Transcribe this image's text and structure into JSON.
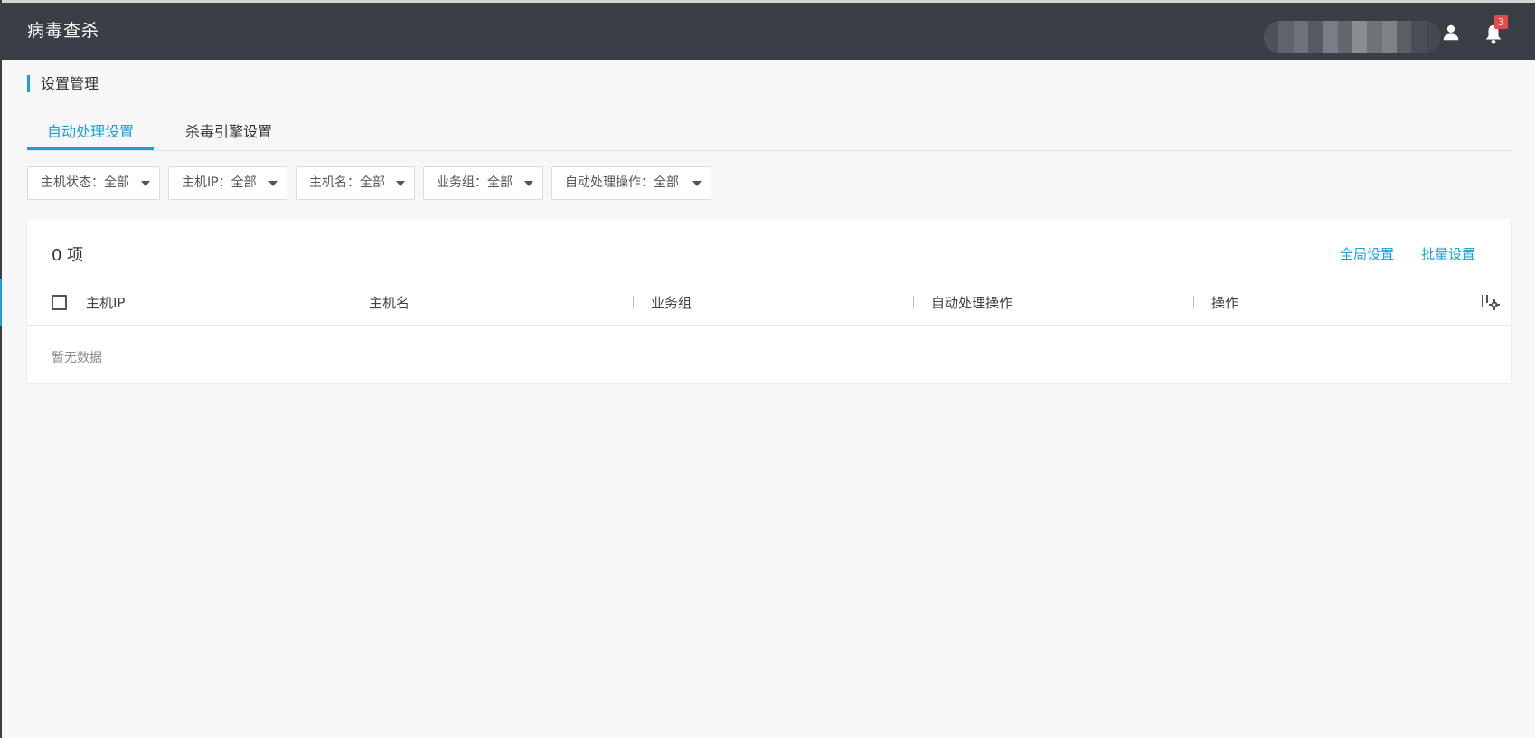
{
  "app": {
    "title": "病毒查杀"
  },
  "header": {
    "notification_count": "3"
  },
  "section": {
    "title": "设置管理"
  },
  "tabs": [
    {
      "label": "自动处理设置",
      "active": true
    },
    {
      "label": "杀毒引擎设置",
      "active": false
    }
  ],
  "filters": [
    {
      "label": "主机状态：全部"
    },
    {
      "label": "主机IP：全部"
    },
    {
      "label": "主机名：全部"
    },
    {
      "label": "业务组：全部"
    },
    {
      "label": "自动处理操作：全部"
    }
  ],
  "table": {
    "count_label": "0 项",
    "actions": {
      "global": "全局设置",
      "batch": "批量设置"
    },
    "columns": [
      "主机IP",
      "主机名",
      "业务组",
      "自动处理操作",
      "操作"
    ],
    "empty_text": "暂无数据"
  },
  "colors": {
    "accent": "#1aa1d9",
    "topbar": "#3a3f46",
    "badge": "#e64a4a"
  },
  "icons": {
    "user": "user-icon",
    "bell": "bell-icon",
    "column_settings": "column-settings-icon"
  }
}
